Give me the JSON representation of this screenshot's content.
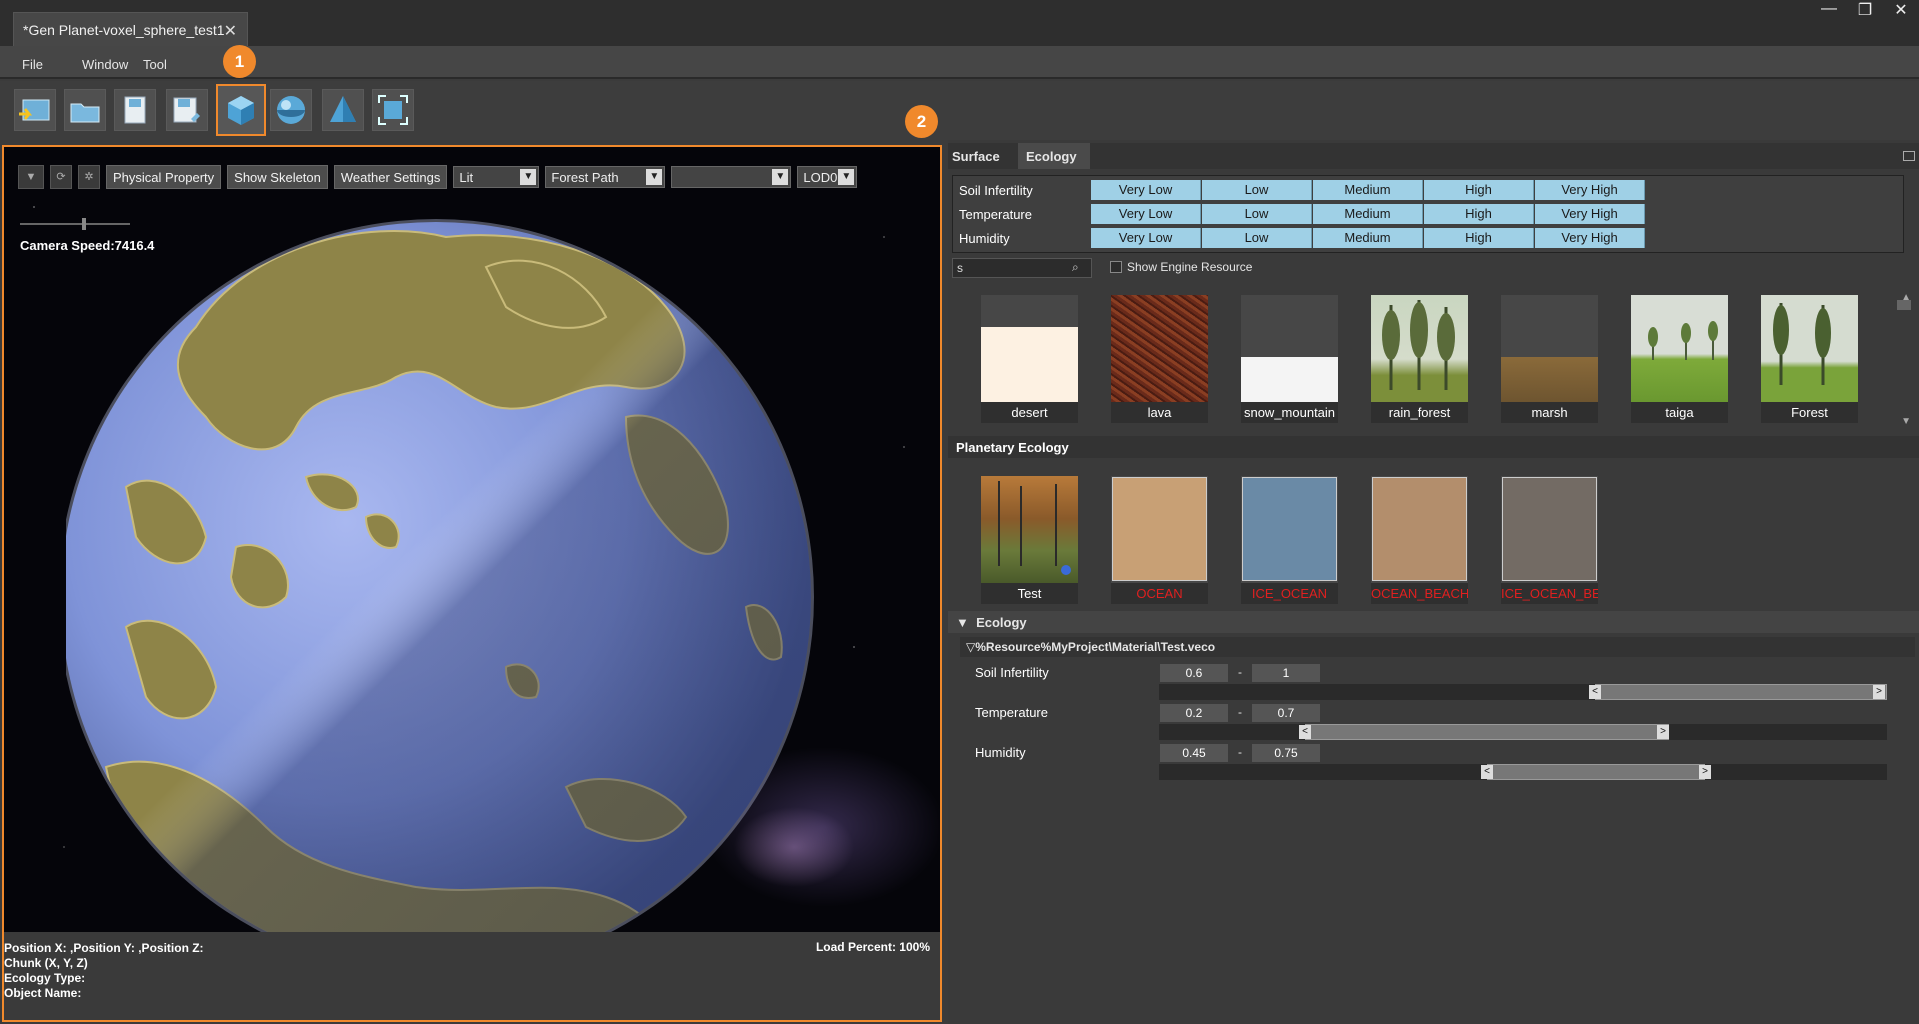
{
  "window": {
    "tab_title": "*Gen Planet-voxel_sphere_test1",
    "close_glyph": "✕",
    "controls": [
      "—",
      "❐",
      "✕"
    ]
  },
  "menu": {
    "file": "File",
    "window": "Window",
    "tool": "Tool"
  },
  "toolbar": {
    "buttons": [
      "import-icon",
      "open-folder-icon",
      "open-icon",
      "save-icon",
      "save-as-icon",
      "voxel-cube-icon",
      "sphere-icon",
      "pyramid-icon",
      "fit-view-icon"
    ],
    "active_index": 5,
    "callout_1": "1",
    "callout_2": "2"
  },
  "viewport": {
    "physical_property": "Physical Property",
    "show_skeleton": "Show Skeleton",
    "weather_settings": "Weather Settings",
    "render_mode": "Lit",
    "path_mode": "Forest Path",
    "empty_combo": "",
    "lod": "LOD0",
    "camera_speed": "Camera Speed:7416.4",
    "position": "Position X: ,Position Y: ,Position Z:",
    "chunk": "Chunk (X, Y, Z)",
    "ecology_type": "Ecology Type:",
    "object_name": "Object Name:",
    "load_percent": "Load Percent: 100%"
  },
  "right_panel": {
    "tab_surface": "Surface",
    "tab_ecology": "Ecology",
    "filter_levels": [
      "Very Low",
      "Low",
      "Medium",
      "High",
      "Very High"
    ],
    "filter_rows": [
      "Soil Infertility",
      "Temperature",
      "Humidity"
    ],
    "search_value": "s",
    "show_engine_resource": "Show Engine Resource",
    "surfaces": [
      "desert",
      "lava",
      "snow_mountain",
      "rain_forest",
      "marsh",
      "taiga",
      "Forest"
    ],
    "planetary_ecology_title": "Planetary Ecology",
    "ecologies": [
      {
        "name": "Test",
        "color": "",
        "error": false
      },
      {
        "name": "OCEAN",
        "color": "#c8a075",
        "error": true
      },
      {
        "name": "ICE_OCEAN",
        "color": "#6a8aa6",
        "error": true
      },
      {
        "name": "OCEAN_BEACH",
        "color": "#b38e6c",
        "error": true
      },
      {
        "name": "ICE_OCEAN_BEAC",
        "color": "#736b64",
        "error": true
      }
    ],
    "ecology_section": "Ecology",
    "resource_path": "%Resource%MyProject\\Material\\Test.veco",
    "params": [
      {
        "label": "Soil Infertility",
        "min": "0.6",
        "max": "1"
      },
      {
        "label": "Temperature",
        "min": "0.2",
        "max": "0.7"
      },
      {
        "label": "Humidity",
        "min": "0.45",
        "max": "0.75"
      }
    ]
  },
  "colors": {
    "accent": "#f0892c",
    "filter_cell": "#9fd0e6",
    "error_text": "#e02020"
  }
}
